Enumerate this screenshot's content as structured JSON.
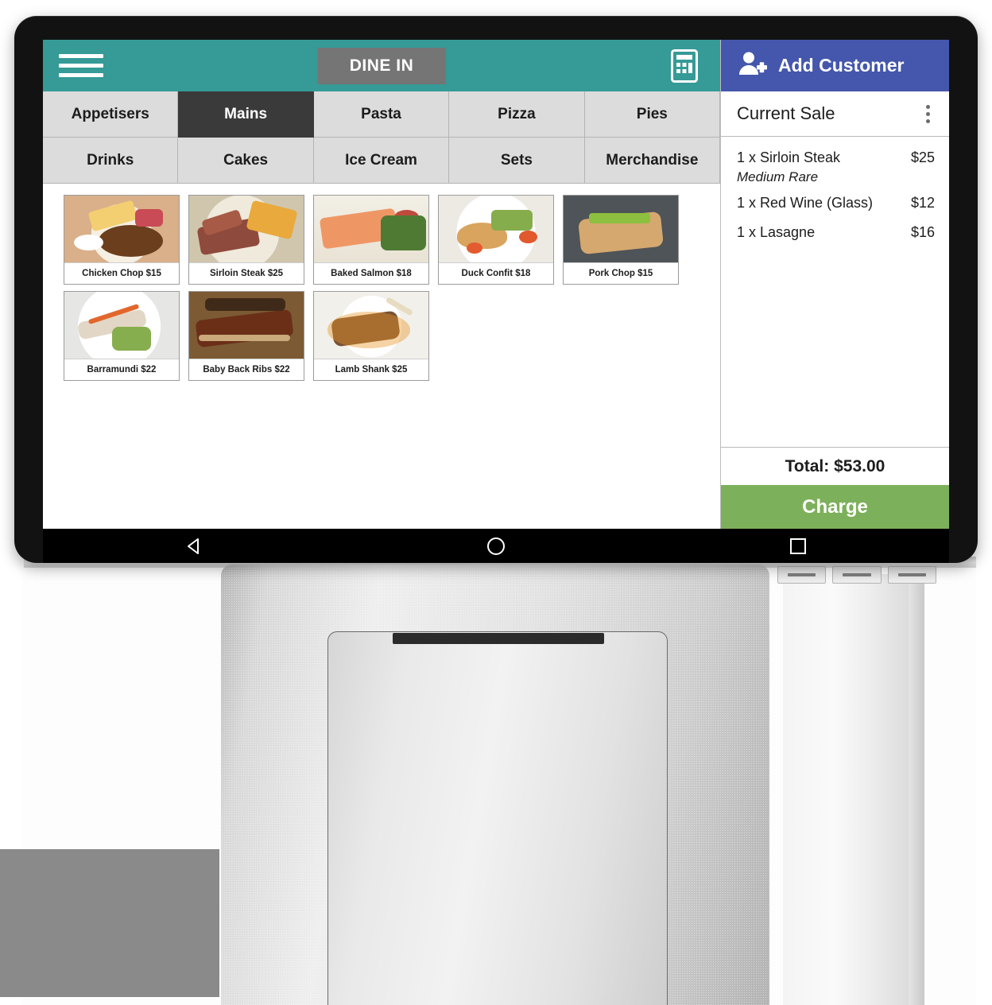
{
  "topbar": {
    "menu_icon": "hamburger-menu-icon",
    "order_type_label": "DINE IN",
    "calculator_icon": "calculator-icon"
  },
  "categories": {
    "row1": [
      {
        "label": "Appetisers",
        "active": false
      },
      {
        "label": "Mains",
        "active": true
      },
      {
        "label": "Pasta",
        "active": false
      },
      {
        "label": "Pizza",
        "active": false
      },
      {
        "label": "Pies",
        "active": false
      }
    ],
    "row2": [
      {
        "label": "Drinks",
        "active": false
      },
      {
        "label": "Cakes",
        "active": false
      },
      {
        "label": "Ice Cream",
        "active": false
      },
      {
        "label": "Sets",
        "active": false
      },
      {
        "label": "Merchandise",
        "active": false
      }
    ]
  },
  "products": [
    {
      "label": "Chicken Chop $15",
      "img": "f-chicken"
    },
    {
      "label": "Sirloin Steak $25",
      "img": "f-steak"
    },
    {
      "label": "Baked Salmon $18",
      "img": "f-salmon"
    },
    {
      "label": "Duck Confit $18",
      "img": "f-duck"
    },
    {
      "label": "Pork Chop $15",
      "img": "f-pork"
    },
    {
      "label": "Barramundi $22",
      "img": "f-barra"
    },
    {
      "label": "Baby Back Ribs $22",
      "img": "f-ribs"
    },
    {
      "label": "Lamb Shank $25",
      "img": "f-lamb"
    }
  ],
  "sale_panel": {
    "add_customer_label": "Add Customer",
    "add_customer_icon": "add-person-icon",
    "title": "Current Sale",
    "overflow_icon": "kebab-menu-icon",
    "items": [
      {
        "name": "1 x Sirloin Steak",
        "price": "$25",
        "modifier": "Medium Rare"
      },
      {
        "name": "1 x Red Wine (Glass)",
        "price": "$12",
        "modifier": ""
      },
      {
        "name": "1 x Lasagne",
        "price": "$16",
        "modifier": ""
      }
    ],
    "total_label": "Total: $53.00",
    "charge_label": "Charge"
  },
  "android_nav": {
    "back_icon": "back-triangle-icon",
    "home_icon": "home-circle-icon",
    "recents_icon": "recents-square-icon"
  },
  "colors": {
    "teal": "#369a97",
    "blue": "#4457ac",
    "green": "#7db05a",
    "active_tab": "#3a3a3a",
    "tab_bg": "#dcdcdc",
    "dine_in_bg": "#757575"
  }
}
